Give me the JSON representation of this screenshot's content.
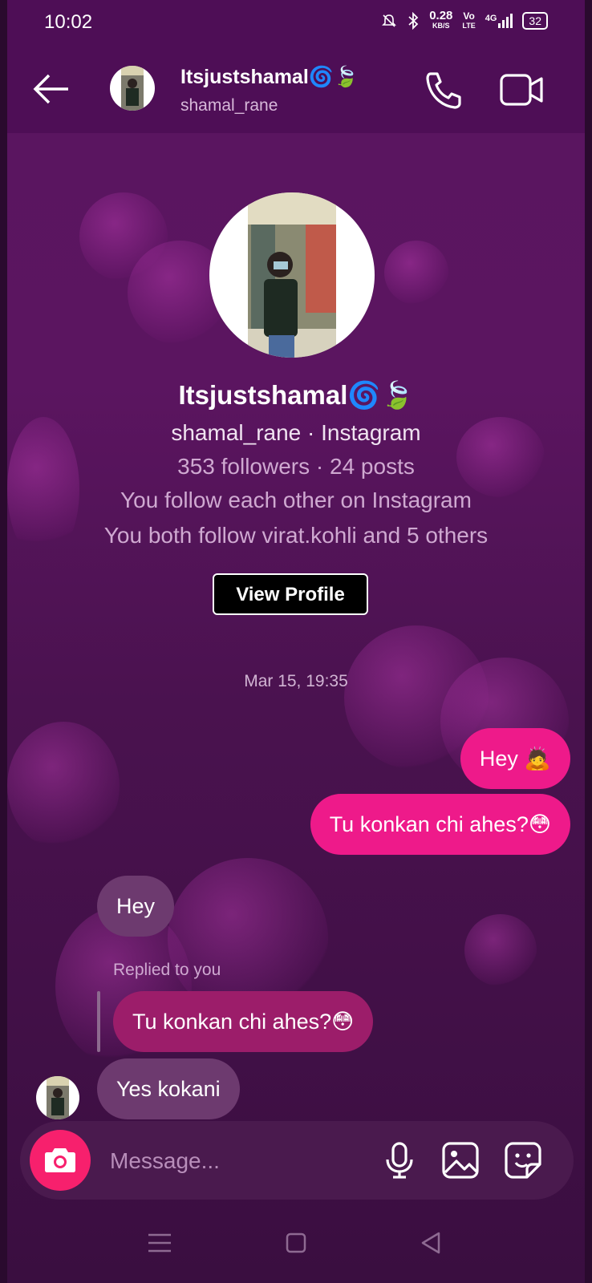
{
  "status_bar": {
    "time": "10:02",
    "net_speed": "0.28",
    "net_unit": "KB/S",
    "volte_top": "Vo",
    "volte_bottom": "LTE",
    "network": "4G",
    "battery": "32"
  },
  "header": {
    "name": "Itsjustshamal🌀🍃",
    "username": "shamal_rane"
  },
  "profile": {
    "name": "Itsjustshamal🌀🍃",
    "subtitle": "shamal_rane · Instagram",
    "stats": "353 followers · 24 posts",
    "follow_status": "You follow each other on Instagram",
    "mutual": "You both follow virat.kohli and 5 others",
    "view_profile_label": "View Profile"
  },
  "conversation": {
    "timestamp": "Mar 15, 19:35",
    "messages": [
      {
        "text": "Hey 🙇",
        "direction": "sent"
      },
      {
        "text": "Tu konkan chi ahes?😳",
        "direction": "sent"
      },
      {
        "text": "Hey",
        "direction": "received"
      },
      {
        "text": "Tu konkan chi ahes?😳",
        "direction": "reply-quote"
      },
      {
        "text": "Yes kokani",
        "direction": "received"
      }
    ],
    "replied_label": "Replied to you"
  },
  "composer": {
    "placeholder": "Message..."
  },
  "colors": {
    "background": "#5a1560",
    "sent_bubble": "#ee1a8a",
    "received_bubble": "#6d3a6f",
    "camera_button": "#f7206d"
  }
}
